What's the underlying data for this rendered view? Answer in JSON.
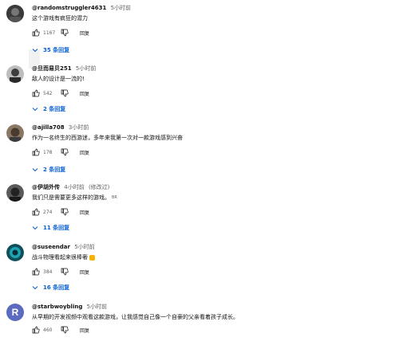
{
  "comments": [
    {
      "author": "@randomstruggler4631",
      "time": "5小时前",
      "text": "这个游戏有疯狂的潜力",
      "likes": "1167",
      "reply_label": "回复",
      "replies_label": "35 条回复",
      "avatar_color": "#3a3a3a"
    },
    {
      "author": "@旦而易贝251",
      "time": "5小时前",
      "text": "敌人的设计是一流的!",
      "likes": "542",
      "reply_label": "回复",
      "replies_label": "2 条回复",
      "avatar_color": "#4a4a4a"
    },
    {
      "author": "@ajilla708",
      "time": "3小时前",
      "text": "作为一名终生的西游迷，多年来我第一次对一款游戏感到兴奋",
      "likes": "178",
      "reply_label": "回复",
      "replies_label": "2 条回复",
      "avatar_color": "#6d5a4a"
    },
    {
      "author": "@伊胡外传",
      "time": "4小时前",
      "edited": "(修改过)",
      "text": "我们只是需要更多这样的游戏。",
      "text_tag": "BR",
      "likes": "274",
      "reply_label": "回复",
      "replies_label": "11 条回复",
      "avatar_color": "#2f2f2f"
    },
    {
      "author": "@suseendar",
      "time": "5小时前",
      "text": "战斗物理看起来很棒奢",
      "likes": "384",
      "reply_label": "回复",
      "replies_label": "16 条回复",
      "avatar_color": "#0e4f5a",
      "emoji_color": "#f4b400"
    },
    {
      "author": "@starbwoybling",
      "time": "5小时前",
      "text": "从早期的开发视频中观看这款游戏，让我感觉自己像一个自豪的父亲看着孩子成长。",
      "likes": "460",
      "reply_label": "回复",
      "avatar_letter": "R",
      "avatar_color": "#5c6bc0"
    }
  ],
  "colors": {
    "link": "#065fd4",
    "muted": "#606060",
    "text": "#0f0f0f"
  }
}
